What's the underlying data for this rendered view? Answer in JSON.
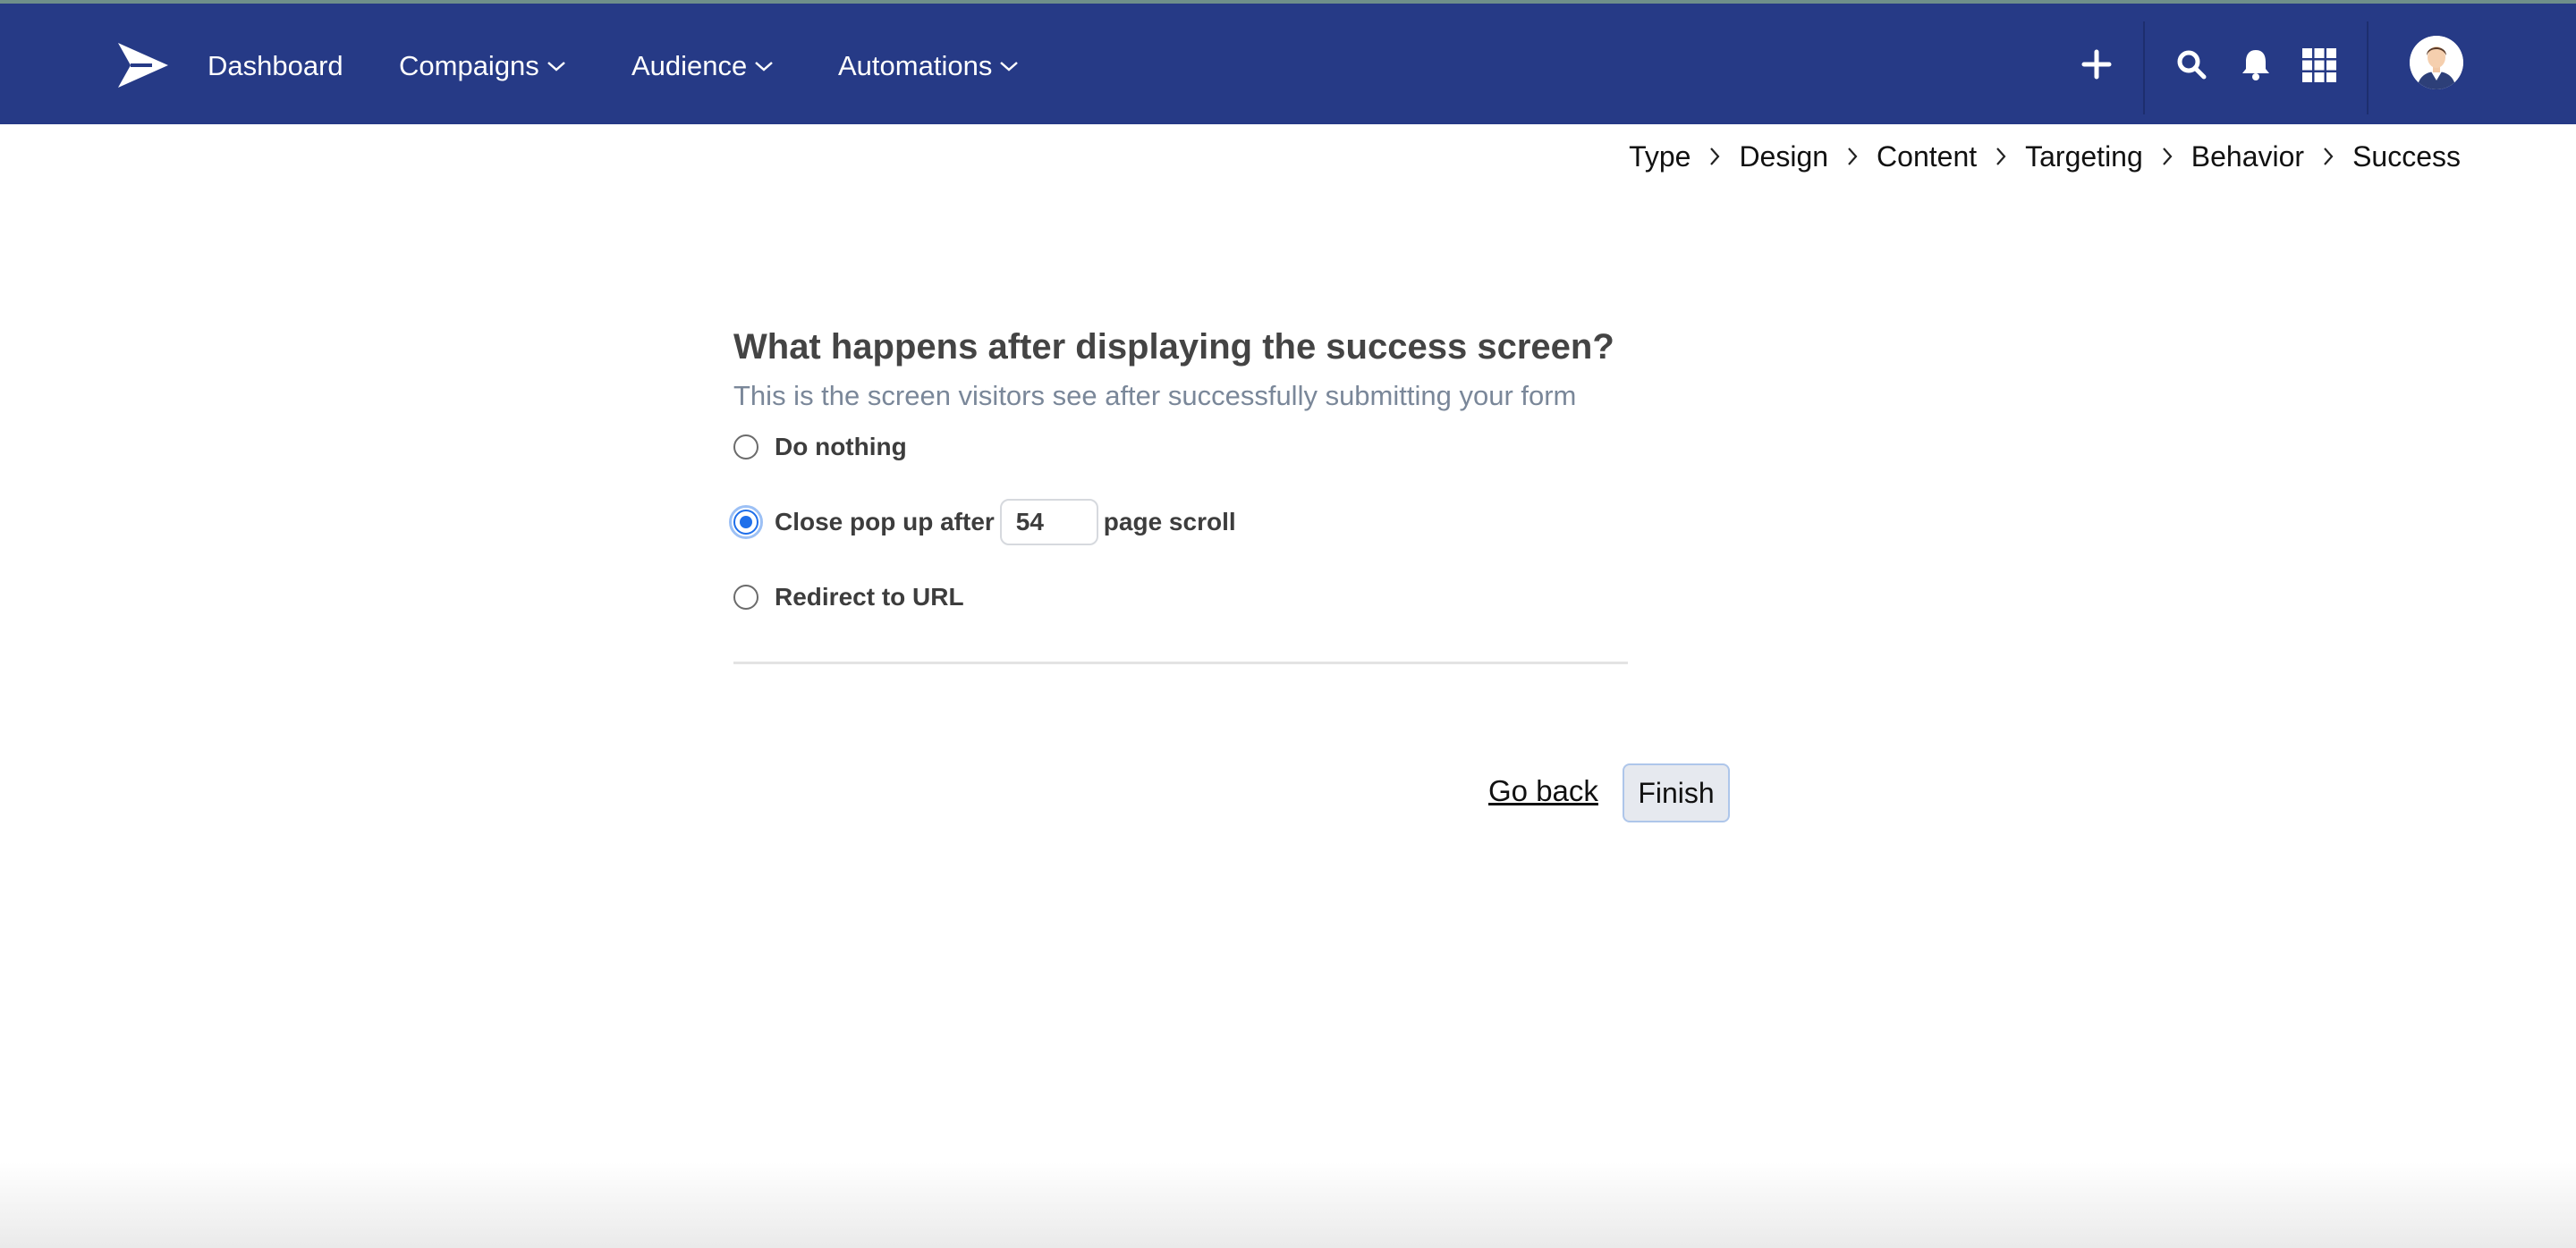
{
  "nav": {
    "links": [
      "Dashboard",
      "Compaigns",
      "Audience",
      "Automations"
    ],
    "icons": [
      "plus-icon",
      "search-icon",
      "bell-icon",
      "grid-icon"
    ],
    "background_color": "#263a86"
  },
  "breadcrumb": {
    "steps": [
      "Type",
      "Design",
      "Content",
      "Targeting",
      "Behavior",
      "Success"
    ]
  },
  "question": {
    "title": "What happens after displaying the success screen?",
    "subtitle": "This is the screen visitors see after successfully submitting your form"
  },
  "options": {
    "do_nothing": "Do nothing",
    "close_before": "Close pop up after",
    "scroll_value": "54",
    "close_after": "page scroll",
    "redirect": "Redirect to URL",
    "selected": "close_popup"
  },
  "actions": {
    "go_back": "Go back",
    "finish": "Finish"
  },
  "colors": {
    "accent": "#1f6fea",
    "subtitle": "#7a8799"
  }
}
